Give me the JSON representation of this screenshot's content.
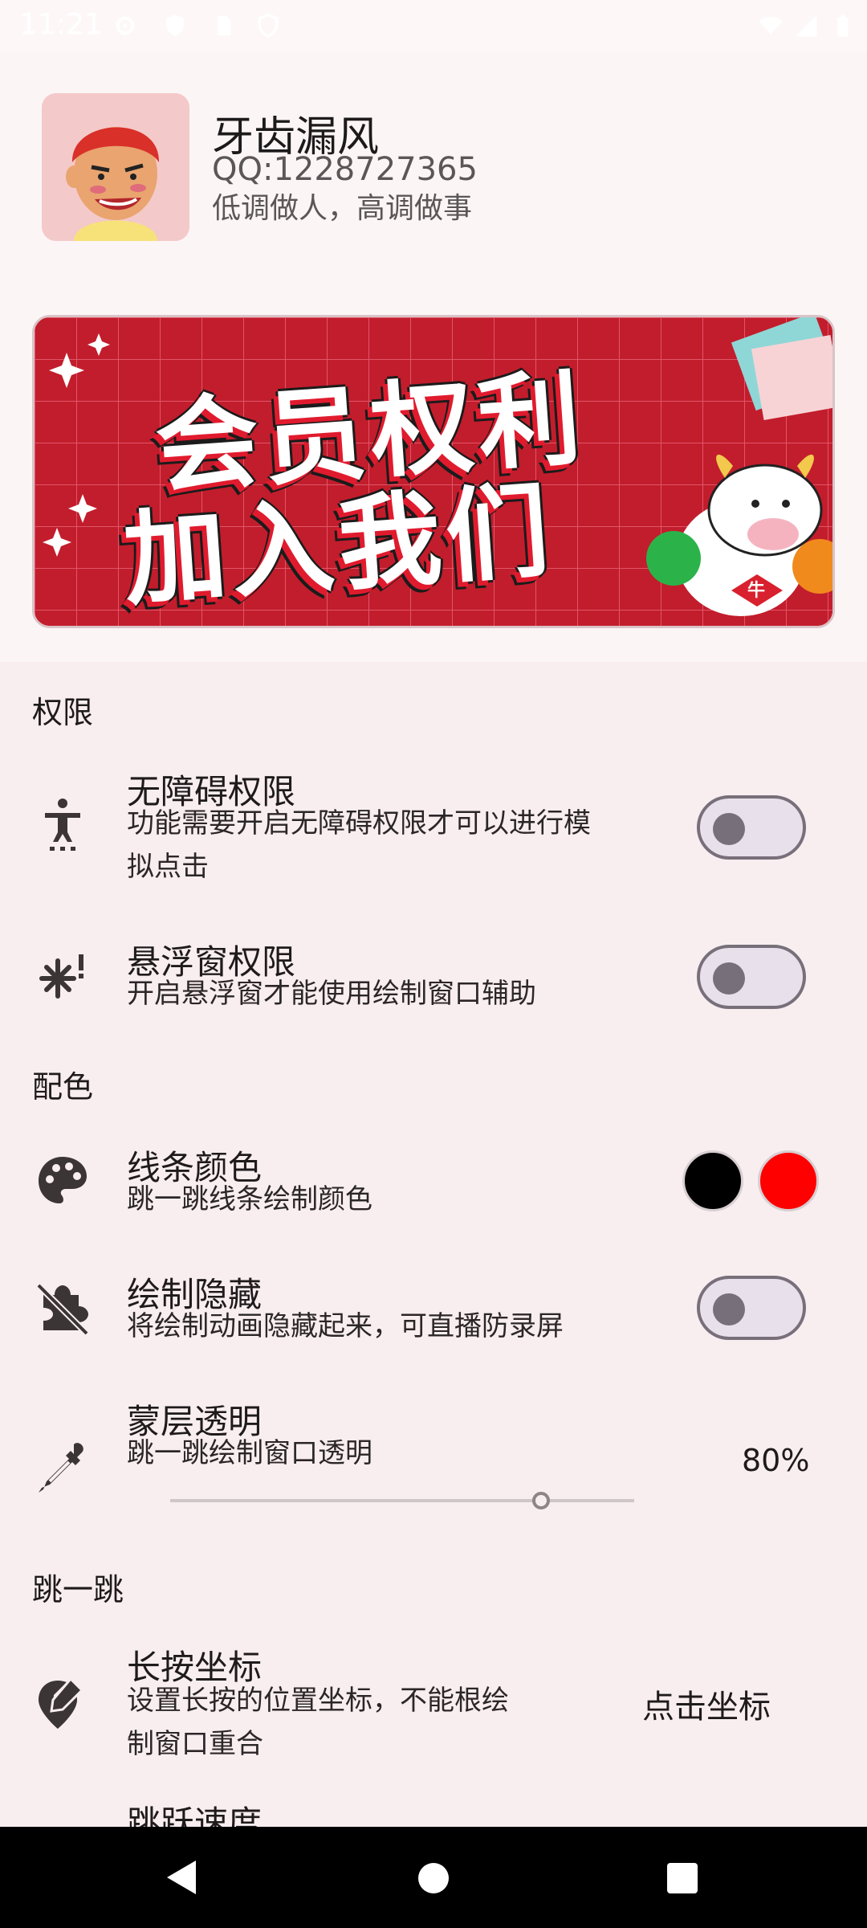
{
  "status_bar": {
    "time": "11:21",
    "icons": [
      "settings-icon",
      "shield-icon",
      "sim-card-icon",
      "vpn-icon",
      "wifi-icon",
      "signal-icon",
      "battery-icon"
    ]
  },
  "profile": {
    "name": "牙齿漏风",
    "qq": "QQ:1228727365",
    "motto": "低调做人，高调做事"
  },
  "banner": {
    "line1": "会员权利",
    "line2": "加入我们",
    "mascot_badge": "牛"
  },
  "sections": {
    "permissions": {
      "title": "权限",
      "accessibility": {
        "title": "无障碍权限",
        "desc_line1": "功能需要开启无障碍权限才可以进行模",
        "desc_line2": "拟点击",
        "enabled": false
      },
      "overlay": {
        "title": "悬浮窗权限",
        "desc": "开启悬浮窗才能使用绘制窗口辅助",
        "enabled": false
      }
    },
    "colors": {
      "title": "配色",
      "line_color": {
        "title": "线条颜色",
        "desc": "跳一跳线条绘制颜色",
        "swatches": [
          "#000000",
          "#ff0000"
        ]
      },
      "hide_drawing": {
        "title": "绘制隐藏",
        "desc": "将绘制动画隐藏起来，可直播防录屏",
        "enabled": false
      },
      "mask_opacity": {
        "title": "蒙层透明",
        "desc": "跳一跳绘制窗口透明",
        "value_label": "80%",
        "value": 0.8
      }
    },
    "jump": {
      "title": "跳一跳",
      "long_press": {
        "title": "长按坐标",
        "desc_line1": "设置长按的位置坐标，不能根绘",
        "desc_line2": "制窗口重合",
        "action": "点击坐标"
      },
      "jump_speed": {
        "title": "跳跃速度"
      }
    }
  },
  "nav": {
    "back": "back-icon",
    "home": "home-icon",
    "recents": "recents-icon"
  }
}
